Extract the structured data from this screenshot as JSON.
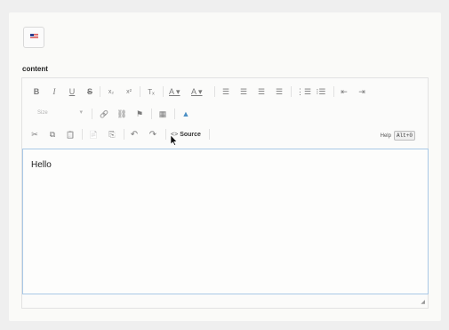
{
  "lang_flag": {
    "icon": "us-flag-icon"
  },
  "field": {
    "label": "content"
  },
  "toolbar": {
    "row1": [
      {
        "name": "bold-button",
        "glyph": "B"
      },
      {
        "name": "italic-button",
        "glyph": "I"
      },
      {
        "name": "underline-button",
        "glyph": "U"
      },
      {
        "name": "strikethrough-button",
        "glyph": "S"
      },
      {
        "name": "subscript-button",
        "glyph": "x₂"
      },
      {
        "name": "superscript-button",
        "glyph": "x²"
      },
      {
        "name": "remove-format-button",
        "glyph": "Tₓ"
      },
      {
        "name": "text-color-button",
        "glyph": "A ▾"
      },
      {
        "name": "background-color-button",
        "glyph": "A ▾"
      },
      {
        "name": "align-left-button",
        "glyph": "☰"
      },
      {
        "name": "align-center-button",
        "glyph": "☰"
      },
      {
        "name": "align-right-button",
        "glyph": "☰"
      },
      {
        "name": "align-justify-button",
        "glyph": "☰"
      },
      {
        "name": "numbered-list-button",
        "glyph": "⋮☰"
      },
      {
        "name": "bulleted-list-button",
        "glyph": "⁝☰"
      },
      {
        "name": "outdent-button",
        "glyph": "⇤"
      },
      {
        "name": "indent-button",
        "glyph": "⇥"
      }
    ],
    "format_select": {
      "value": "Size"
    },
    "row2": [
      {
        "name": "link-button",
        "glyph": "🔗"
      },
      {
        "name": "unlink-button",
        "glyph": "⛓"
      },
      {
        "name": "anchor-button",
        "glyph": "⚑"
      },
      {
        "name": "table-button",
        "glyph": "▦"
      },
      {
        "name": "image-button",
        "glyph": "▲"
      }
    ],
    "row3": [
      {
        "name": "cut-button",
        "glyph": "✂"
      },
      {
        "name": "copy-button",
        "glyph": "⧉"
      },
      {
        "name": "paste-button",
        "glyph": "📋"
      },
      {
        "name": "paste-text-button",
        "glyph": "📄"
      },
      {
        "name": "paste-word-button",
        "glyph": "⎘"
      },
      {
        "name": "undo-button",
        "glyph": "↶"
      },
      {
        "name": "redo-button",
        "glyph": "↷"
      }
    ],
    "source": {
      "code_glyph": "<>",
      "label": "Source"
    },
    "help": {
      "label": "Help",
      "shortcut": "Alt+0"
    }
  },
  "editor": {
    "content": "Hello"
  }
}
